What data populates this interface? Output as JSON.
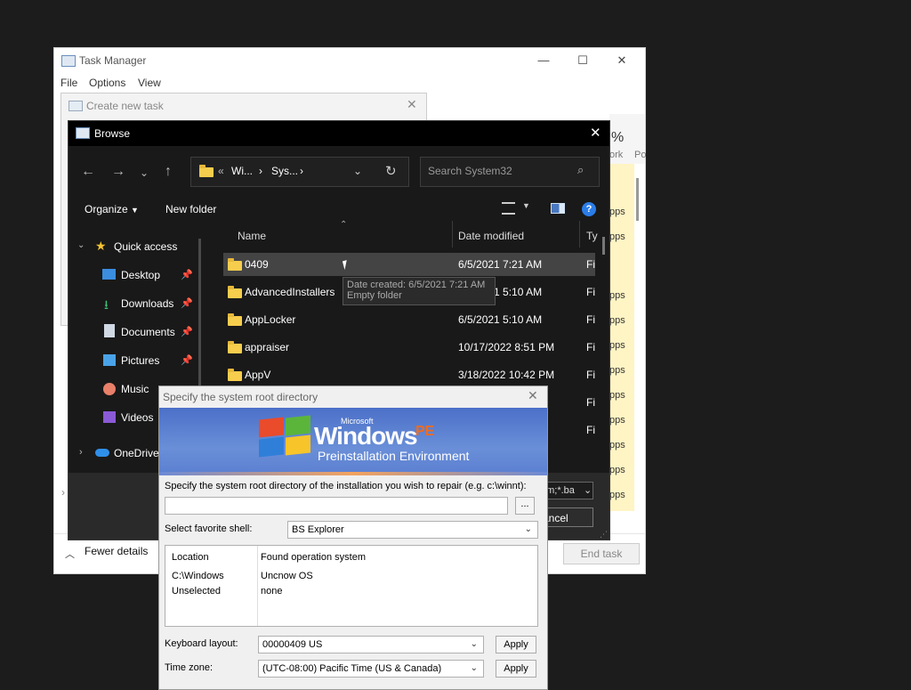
{
  "task_manager": {
    "title": "Task Manager",
    "menu": [
      "File",
      "Options",
      "View"
    ],
    "percent_header": "%",
    "col_ork": "ork",
    "col_po": "Po",
    "apps_labels": [
      "pps",
      "pps",
      "pps",
      "pps",
      "pps",
      "pps",
      "pps",
      "pps",
      "pps",
      "pps",
      "pps",
      "pps"
    ],
    "fewer_details": "Fewer details",
    "end_task": "End task"
  },
  "create_task": {
    "title": "Create new task"
  },
  "browse": {
    "title": "Browse",
    "address": {
      "prefix": "«",
      "seg1": "Wi...",
      "seg2": "Sys..."
    },
    "search_placeholder": "Search System32",
    "toolbar": {
      "organize": "Organize",
      "new_folder": "New folder"
    },
    "headers": {
      "name": "Name",
      "date": "Date modified",
      "type": "Ty"
    },
    "nav": {
      "quick_access": "Quick access",
      "items": [
        "Desktop",
        "Downloads",
        "Documents",
        "Pictures",
        "Music",
        "Videos"
      ],
      "onedrive": "OneDrive"
    },
    "rows": [
      {
        "name": "0409",
        "date": "6/5/2021 7:21 AM",
        "type": "Fi"
      },
      {
        "name": "AdvancedInstallers",
        "date": "6/5/2021 5:10 AM",
        "type": "Fi"
      },
      {
        "name": "AppLocker",
        "date": "6/5/2021 5:10 AM",
        "type": "Fi"
      },
      {
        "name": "appraiser",
        "date": "10/17/2022 8:51 PM",
        "type": "Fi"
      },
      {
        "name": "AppV",
        "date": "3/18/2022 10:42 PM",
        "type": "Fi"
      },
      {
        "type": "Fi"
      },
      {
        "type": "Fi"
      }
    ],
    "tooltip": {
      "line1": "Date created: 6/5/2021 7:21 AM",
      "line2": "Empty folder"
    },
    "filter_partial": "om;*.ba",
    "cancel_partial": "ancel"
  },
  "pe": {
    "title": "Specify the system root directory",
    "banner": {
      "microsoft": "Microsoft",
      "windows": "Windows",
      "pe": "PE",
      "subtitle": "Preinstallation Environment"
    },
    "root_prompt": "Specify the system root directory of the installation you wish to repair (e.g. c:\\winnt):",
    "browse_btn": "...",
    "shell_label": "Select favorite shell:",
    "shell_value": "BS Explorer",
    "table": {
      "headers": [
        "Location",
        "Found operation system"
      ],
      "rows": [
        [
          "C:\\Windows",
          "Uncnow OS"
        ],
        [
          "Unselected",
          "none"
        ]
      ]
    },
    "keyboard_label": "Keyboard layout:",
    "keyboard_value": "00000409 US",
    "timezone_label": "Time zone:",
    "timezone_value": "(UTC-08:00) Pacific Time (US & Canada)",
    "apply": "Apply"
  },
  "colors": {
    "folder": "#f7cd4d",
    "highlight_yellow": "#fff4c4",
    "selected_row": "#444444",
    "help_blue": "#2b7de9"
  }
}
